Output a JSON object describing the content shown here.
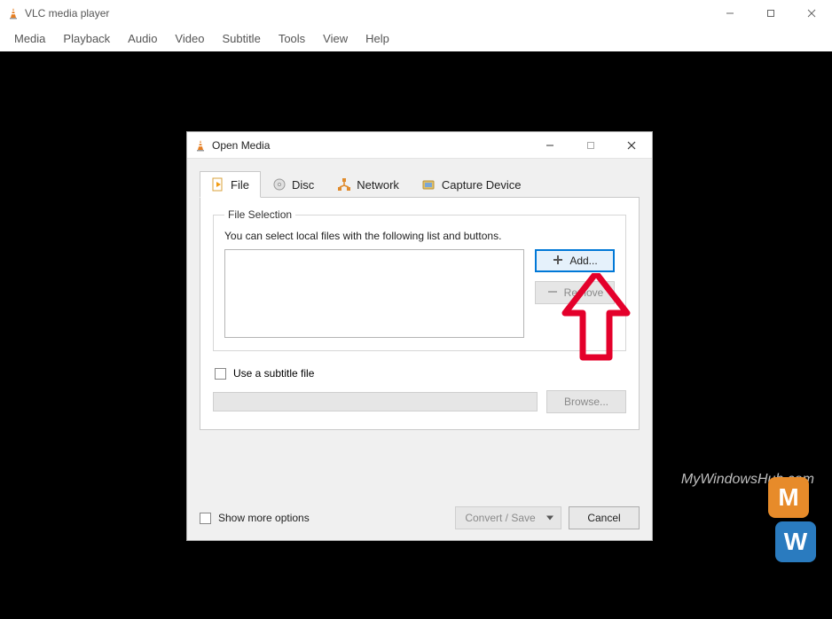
{
  "main_window": {
    "title": "VLC media player",
    "menus": [
      "Media",
      "Playback",
      "Audio",
      "Video",
      "Subtitle",
      "Tools",
      "View",
      "Help"
    ]
  },
  "dialog": {
    "title": "Open Media",
    "tabs": [
      {
        "label": "File",
        "active": true
      },
      {
        "label": "Disc",
        "active": false
      },
      {
        "label": "Network",
        "active": false
      },
      {
        "label": "Capture Device",
        "active": false
      }
    ],
    "file_selection": {
      "legend": "File Selection",
      "hint": "You can select local files with the following list and buttons.",
      "add_label": "Add...",
      "remove_label": "Remove"
    },
    "subtitle": {
      "checkbox_label": "Use a subtitle file",
      "browse_label": "Browse..."
    },
    "show_more_label": "Show more options",
    "convert_label": "Convert / Save",
    "cancel_label": "Cancel"
  },
  "watermark": "MyWindowsHub.com"
}
